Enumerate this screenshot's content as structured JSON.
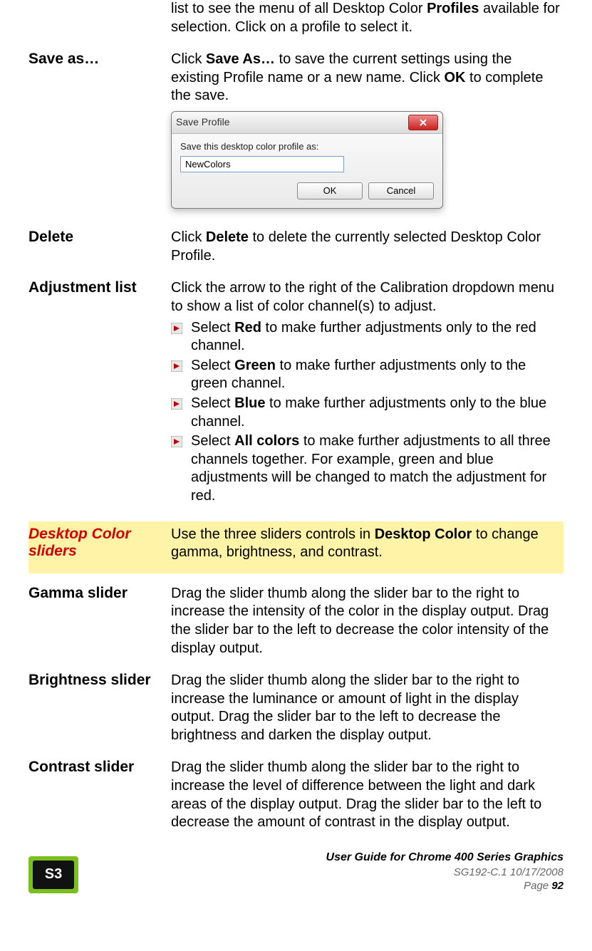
{
  "partial_row": {
    "text_before": "list to see the menu of all Desktop Color ",
    "bold": "Profiles",
    "text_after": " available for selection. Click on a profile to select it."
  },
  "save_as": {
    "term": "Save as…",
    "p1a": "Click ",
    "p1b": "Save As…",
    "p1c": " to save the current settings using the existing Profile name or a new name. Click ",
    "p1d": "OK",
    "p1e": " to complete the save."
  },
  "dialog": {
    "title": "Save Profile",
    "label": "Save this desktop color profile as:",
    "value": "NewColors",
    "ok": "OK",
    "cancel": "Cancel"
  },
  "delete": {
    "term": "Delete",
    "a": "Click ",
    "b": "Delete",
    "c": " to delete the currently selected Desktop Color Profile."
  },
  "adjust": {
    "term": "Adjustment list",
    "intro": "Click the arrow to the right of the Calibration dropdown menu to show a list of color channel(s) to adjust.",
    "items": [
      {
        "a": "Select ",
        "b": "Red",
        "c": " to make further adjustments only to the red channel."
      },
      {
        "a": "Select ",
        "b": "Green",
        "c": " to make further adjustments only to the green channel."
      },
      {
        "a": "Select ",
        "b": "Blue",
        "c": " to make further adjustments only to the blue channel."
      },
      {
        "a": "Select ",
        "b": "All colors",
        "c": " to make further adjustments to all three channels together. For example, green and blue adjustments will be changed to match the adjustment for red."
      }
    ]
  },
  "sliders_header": {
    "term": "Desktop Color sliders",
    "a": "Use the three sliders controls in ",
    "b": "Desktop Color",
    "c": " to change gamma, brightness, and contrast."
  },
  "gamma": {
    "term": "Gamma slider",
    "text": "Drag the slider thumb along the slider bar to the right to increase the intensity of the color in the display output. Drag the slider bar to the left to decrease the color intensity of the display output."
  },
  "brightness": {
    "term": "Brightness slider",
    "text": "Drag the slider thumb along the slider bar to the right to increase the luminance or amount of light in the display output. Drag the slider bar to the left to decrease the brightness and darken the display output."
  },
  "contrast": {
    "term": "Contrast slider",
    "text": "Drag the slider thumb along the slider bar to the right to increase the level of difference between the light and dark areas of the display output. Drag the slider bar to the left to decrease the amount of contrast in the display output."
  },
  "footer": {
    "logo": "S3",
    "line1": "User Guide for Chrome 400 Series Graphics",
    "line2": "SG192-C.1   10/17/2008",
    "page_label": "Page ",
    "page_num": "92"
  }
}
